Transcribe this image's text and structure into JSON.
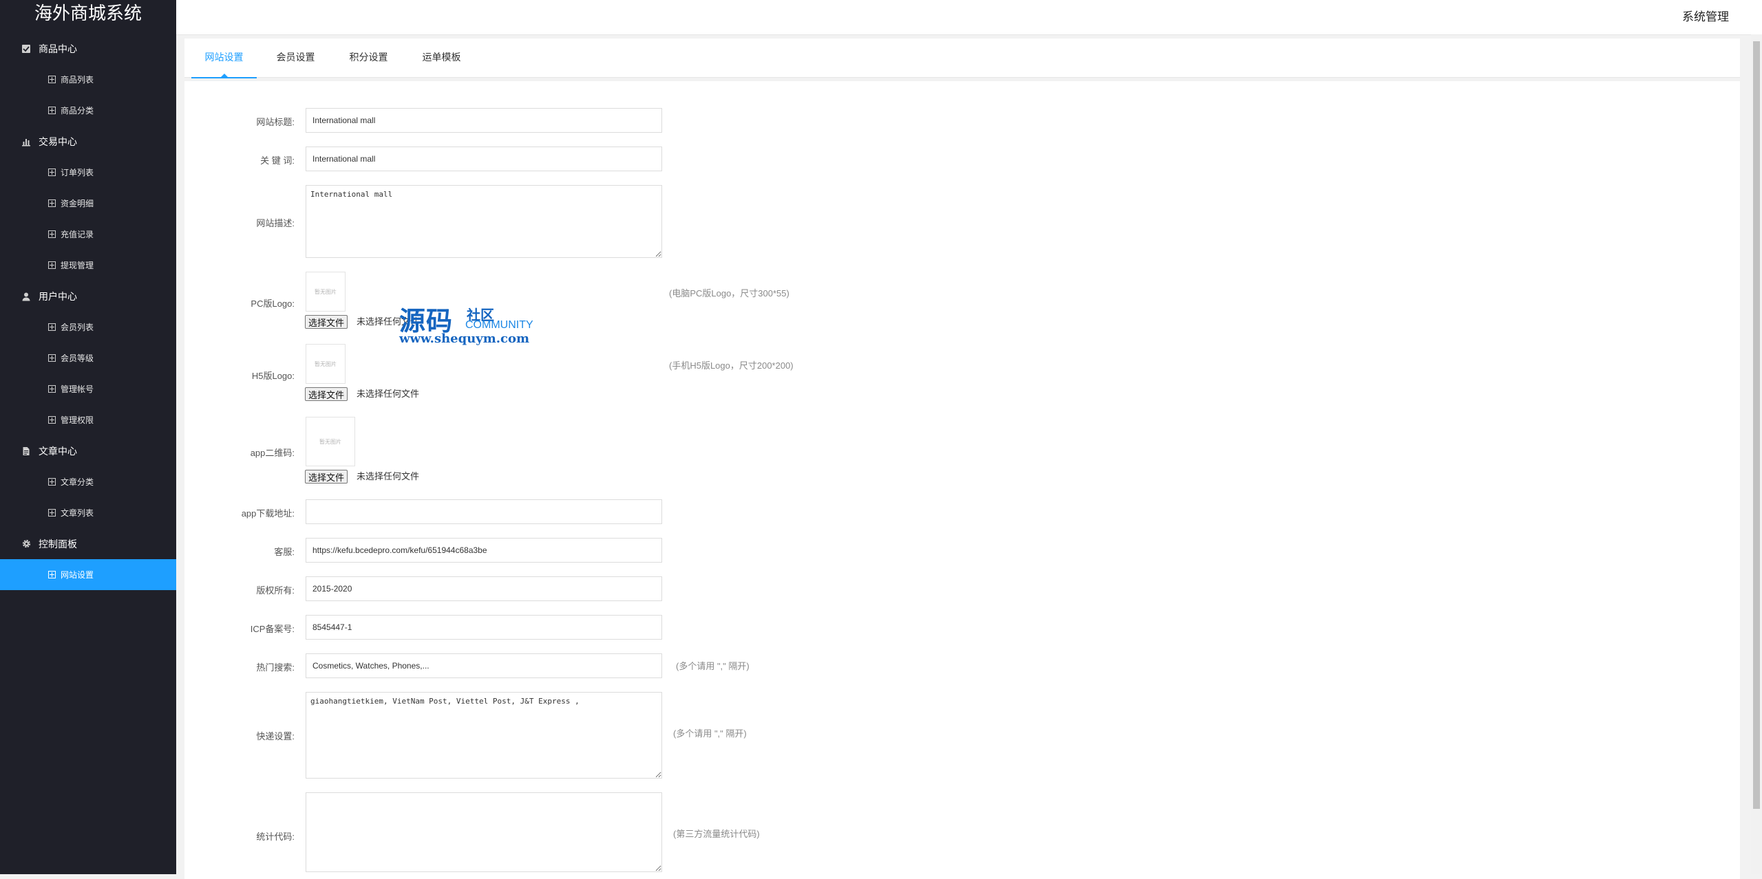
{
  "app": {
    "title": "海外商城系统",
    "header_right": "系统管理"
  },
  "sidebar": {
    "groups": [
      {
        "label": "商品中心",
        "icon": "goods-icon",
        "items": [
          {
            "label": "商品列表"
          },
          {
            "label": "商品分类"
          }
        ]
      },
      {
        "label": "交易中心",
        "icon": "chart-icon",
        "items": [
          {
            "label": "订单列表"
          },
          {
            "label": "资金明细"
          },
          {
            "label": "充值记录"
          },
          {
            "label": "提现管理"
          }
        ]
      },
      {
        "label": "用户中心",
        "icon": "user-icon",
        "items": [
          {
            "label": "会员列表"
          },
          {
            "label": "会员等级"
          },
          {
            "label": "管理帐号"
          },
          {
            "label": "管理权限"
          }
        ]
      },
      {
        "label": "文章中心",
        "icon": "document-icon",
        "items": [
          {
            "label": "文章分类"
          },
          {
            "label": "文章列表"
          }
        ]
      },
      {
        "label": "控制面板",
        "icon": "gear-icon",
        "items": [
          {
            "label": "网站设置",
            "active": true
          }
        ]
      }
    ],
    "accent_color": "#1e9fff",
    "bg_color": "#1f2029"
  },
  "tabs": [
    {
      "label": "网站设置",
      "active": true
    },
    {
      "label": "会员设置"
    },
    {
      "label": "积分设置"
    },
    {
      "label": "运单模板"
    }
  ],
  "form": {
    "site_title": {
      "label": "网站标题:",
      "value": "International mall"
    },
    "keywords": {
      "label": "关 键 词:",
      "value": "International mall"
    },
    "description": {
      "label": "网站描述:",
      "value": "International mall"
    },
    "pc_logo": {
      "label": "PC版Logo:",
      "placeholder_img": "暂无图片",
      "button": "选择文件",
      "file_text": "未选择任何文件",
      "hint": "(电脑PC版Logo，尺寸300*55)"
    },
    "h5_logo": {
      "label": "H5版Logo:",
      "placeholder_img": "暂无图片",
      "button": "选择文件",
      "file_text": "未选择任何文件",
      "hint": "(手机H5版Logo，尺寸200*200)"
    },
    "app_qr": {
      "label": "app二维码:",
      "placeholder_img": "暂无图片",
      "button": "选择文件",
      "file_text": "未选择任何文件"
    },
    "app_download": {
      "label": "app下载地址:",
      "value": ""
    },
    "customer_service": {
      "label": "客服:",
      "value": "https://kefu.bcedepro.com/kefu/651944c68a3be"
    },
    "copyright": {
      "label": "版权所有:",
      "value": "2015-2020"
    },
    "icp": {
      "label": "ICP备案号:",
      "value": "8545447-1"
    },
    "hot_search": {
      "label": "热门搜索:",
      "value": "Cosmetics, Watches, Phones,...",
      "hint": "(多个请用 \",\" 隔开)"
    },
    "express": {
      "label": "快递设置:",
      "value": "giaohangtietkiem, VietNam Post, Viettel Post, J&T Express ,",
      "hint": "(多个请用 \",\" 隔开)"
    },
    "stats_code": {
      "label": "统计代码:",
      "value": "",
      "hint": "(第三方流量统计代码)"
    }
  },
  "watermark": {
    "big": "源码",
    "small": "社区",
    "en": "COMMUNITY",
    "url": "www.shequym.com"
  }
}
